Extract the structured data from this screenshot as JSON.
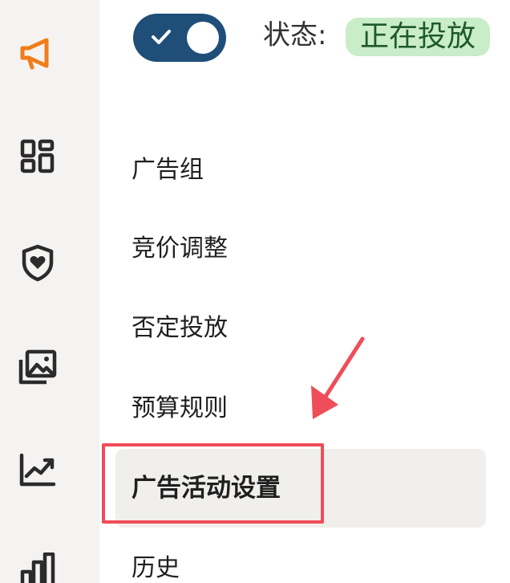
{
  "sidebar": {
    "icons": [
      {
        "name": "megaphone-icon",
        "color": "#f07d1a"
      },
      {
        "name": "grid-icon",
        "color": "#2b2b2b"
      },
      {
        "name": "shield-heart-icon",
        "color": "#2b2b2b"
      },
      {
        "name": "image-gallery-icon",
        "color": "#2b2b2b"
      },
      {
        "name": "line-chart-icon",
        "color": "#2b2b2b"
      },
      {
        "name": "bar-chart-icon",
        "color": "#2b2b2b"
      }
    ]
  },
  "header": {
    "toggle_on": true,
    "status_label": "状态:",
    "status_value": "正在投放"
  },
  "menu": {
    "items": [
      {
        "label": "广告组"
      },
      {
        "label": "竞价调整"
      },
      {
        "label": "否定投放"
      },
      {
        "label": "预算规则"
      },
      {
        "label": "广告活动设置",
        "active": true
      },
      {
        "label": "历史"
      }
    ]
  },
  "colors": {
    "accent": "#f07d1a",
    "toggle": "#1f4e79",
    "badge_bg": "#c9ecc9",
    "annotation": "#ef4d59"
  }
}
